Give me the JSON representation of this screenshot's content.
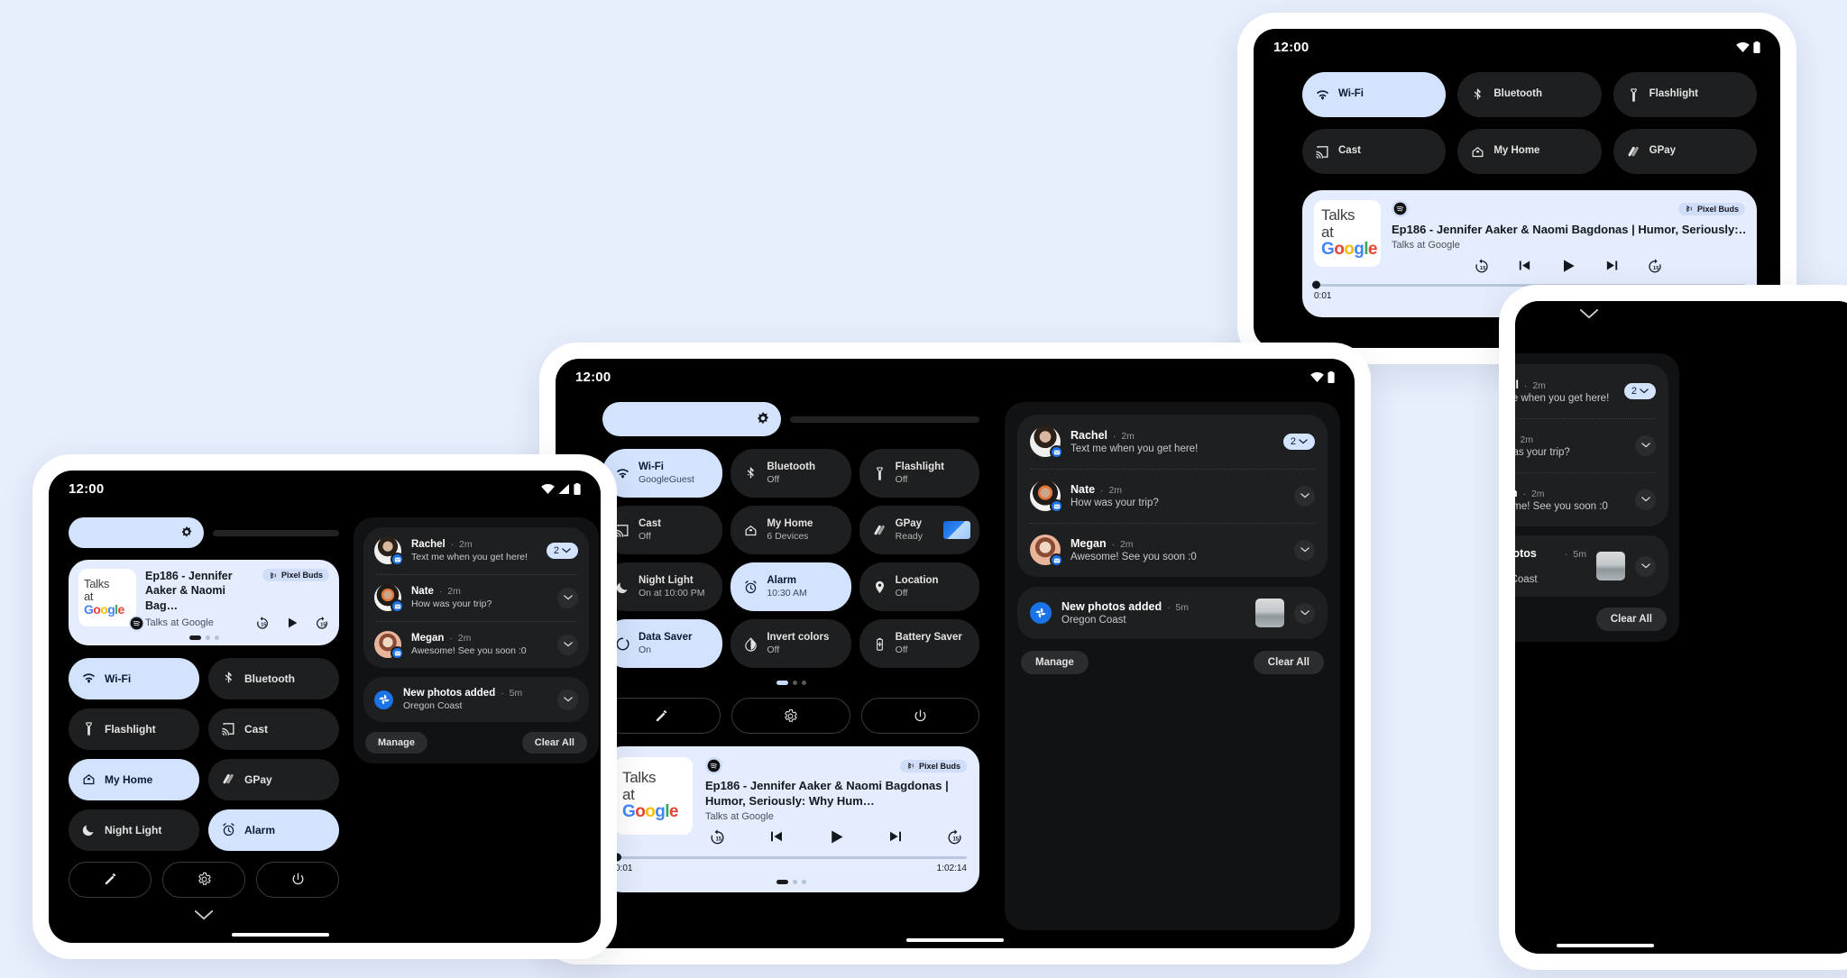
{
  "background_color": "#e7eefc",
  "accent_on": "#d3e2fd",
  "status_bar": {
    "clock": "12:00",
    "icons": [
      "wifi-icon",
      "signal-icon",
      "battery-icon"
    ]
  },
  "quick_settings": {
    "brightness_label": "brightness-slider",
    "tiles_compact": [
      {
        "label": "Wi-Fi",
        "icon": "wifi-icon",
        "state": "on"
      },
      {
        "label": "Bluetooth",
        "icon": "bluetooth-icon",
        "state": "off"
      },
      {
        "label": "Flashlight",
        "icon": "flashlight-icon",
        "state": "off"
      },
      {
        "label": "Cast",
        "icon": "cast-icon",
        "state": "off"
      },
      {
        "label": "My Home",
        "icon": "home-icon",
        "state": "on"
      },
      {
        "label": "GPay",
        "icon": "gpay-icon",
        "state": "off"
      },
      {
        "label": "Night Light",
        "icon": "moon-icon",
        "state": "off"
      },
      {
        "label": "Alarm",
        "icon": "alarm-icon",
        "state": "on"
      }
    ],
    "tiles_landscape": [
      {
        "label": "Wi-Fi",
        "icon": "wifi-icon",
        "state": "on"
      },
      {
        "label": "Bluetooth",
        "icon": "bluetooth-icon",
        "state": "off"
      },
      {
        "label": "Flashlight",
        "icon": "flashlight-icon",
        "state": "off"
      },
      {
        "label": "Cast",
        "icon": "cast-icon",
        "state": "off"
      },
      {
        "label": "My Home",
        "icon": "home-icon",
        "state": "off"
      },
      {
        "label": "GPay",
        "icon": "gpay-icon",
        "state": "off"
      }
    ],
    "tiles_detailed": [
      {
        "label": "Wi-Fi",
        "sub": "GoogleGuest",
        "icon": "wifi-icon",
        "state": "on"
      },
      {
        "label": "Bluetooth",
        "sub": "Off",
        "icon": "bluetooth-icon",
        "state": "off"
      },
      {
        "label": "Flashlight",
        "sub": "Off",
        "icon": "flashlight-icon",
        "state": "off"
      },
      {
        "label": "Cast",
        "sub": "Off",
        "icon": "cast-icon",
        "state": "off"
      },
      {
        "label": "My Home",
        "sub": "6 Devices",
        "icon": "home-icon",
        "state": "off"
      },
      {
        "label": "GPay",
        "sub": "Ready",
        "icon": "gpay-icon",
        "state": "off",
        "card": true
      },
      {
        "label": "Night Light",
        "sub": "On at 10:00 PM",
        "icon": "moon-icon",
        "state": "off"
      },
      {
        "label": "Alarm",
        "sub": "10:30 AM",
        "icon": "alarm-icon",
        "state": "on"
      },
      {
        "label": "Location",
        "sub": "Off",
        "icon": "location-icon",
        "state": "off"
      },
      {
        "label": "Data Saver",
        "sub": "On",
        "icon": "datasaver-icon",
        "state": "on"
      },
      {
        "label": "Invert colors",
        "sub": "Off",
        "icon": "invert-icon",
        "state": "off"
      },
      {
        "label": "Battery Saver",
        "sub": "Off",
        "icon": "battery-saver-icon",
        "state": "off"
      }
    ],
    "page_dots": {
      "count": 3,
      "active_index": 0
    },
    "footer_buttons": [
      {
        "name": "edit-button",
        "icon": "pencil-icon"
      },
      {
        "name": "settings-button",
        "icon": "gear-icon"
      },
      {
        "name": "power-button",
        "icon": "power-icon"
      }
    ]
  },
  "media_player": {
    "app_icon": "spotify-icon",
    "output_chip": "Pixel Buds",
    "output_icon": "bluetooth-buds-icon",
    "title_full": "Ep186 - Jennifer Aaker & Naomi Bagdonas | Humor, Seriously:…",
    "title_two_line": "Ep186 - Jennifer Aaker & Naomi Bagdonas | Humor, Seriously: Why Hum…",
    "title_short": "Ep186 - Jennifer Aaker & Naomi Bag…",
    "subtitle": "Talks at Google",
    "artwork": {
      "line1": "Talks",
      "line2": "at",
      "line3": "Google"
    },
    "elapsed": "0:01",
    "duration_phone": "1:02.14",
    "duration_tablet": "1:02:14",
    "controls": [
      "replay-15-icon",
      "previous-icon",
      "play-icon",
      "next-icon",
      "forward-15-icon"
    ],
    "controls_compact": [
      "replay-15-icon",
      "play-icon",
      "forward-15-icon"
    ],
    "page_dots": {
      "count": 3,
      "active_index": 0
    }
  },
  "notifications": {
    "messages": [
      {
        "name": "Rachel",
        "time": "2m",
        "message": "Text me when you get here!",
        "badge": "message-icon",
        "count": "2"
      },
      {
        "name": "Nate",
        "time": "2m",
        "message": "How was your trip?",
        "badge": "message-icon"
      },
      {
        "name": "Megan",
        "time": "2m",
        "message": "Awesome! See you soon :0",
        "badge": "message-icon"
      }
    ],
    "photos": {
      "title": "New photos added",
      "time": "5m",
      "subtitle": "Oregon Coast",
      "icon": "google-photos-icon",
      "thumbnail": "coast-photo-thumbnail"
    },
    "separator": "·",
    "actions": {
      "manage": "Manage",
      "clear_all": "Clear All"
    }
  }
}
